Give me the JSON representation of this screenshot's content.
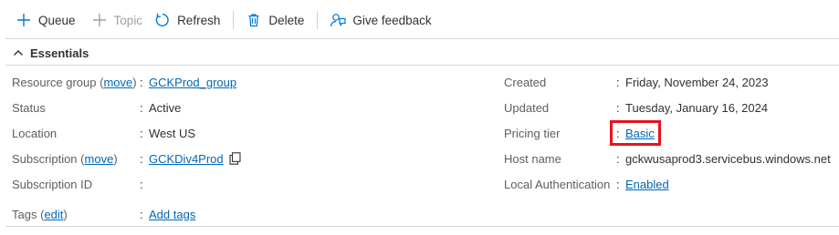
{
  "toolbar": {
    "queue_label": "Queue",
    "topic_label": "Topic",
    "refresh_label": "Refresh",
    "delete_label": "Delete",
    "feedback_label": "Give feedback"
  },
  "essentials": {
    "title": "Essentials"
  },
  "left": {
    "resource_group": {
      "label": "Resource group",
      "paren_open": "(",
      "move": "move",
      "paren_close": ")",
      "colon": ":",
      "value": "GCKProd_group"
    },
    "status": {
      "label": "Status",
      "colon": ":",
      "value": "Active"
    },
    "location": {
      "label": "Location",
      "colon": ":",
      "value": "West US"
    },
    "subscription": {
      "label": "Subscription",
      "paren_open": "(",
      "move": "move",
      "paren_close": ")",
      "colon": ":",
      "value": "GCKDiv4Prod"
    },
    "subscription_id": {
      "label": "Subscription ID",
      "colon": ":",
      "value": ""
    },
    "tags": {
      "label": "Tags",
      "paren_open": "(",
      "edit": "edit",
      "paren_close": ")",
      "colon": ":",
      "value": "Add tags"
    }
  },
  "right": {
    "created": {
      "label": "Created",
      "colon": ":",
      "value": "Friday, November 24, 2023"
    },
    "updated": {
      "label": "Updated",
      "colon": ":",
      "value": "Tuesday, January 16, 2024"
    },
    "pricing_tier": {
      "label": "Pricing tier",
      "colon": ":",
      "value": "Basic"
    },
    "host_name": {
      "label": "Host name",
      "colon": ":",
      "value": "gckwusaprod3.servicebus.windows.net"
    },
    "local_auth": {
      "label": "Local Authentication",
      "colon": ":",
      "value": "Enabled"
    }
  },
  "colors": {
    "link": "#0067b8",
    "highlight": "#e8121e",
    "accent_icon": "#0078d4"
  },
  "icons": {
    "queue": "plus-icon",
    "topic": "plus-icon",
    "refresh": "refresh-icon",
    "delete": "trash-icon",
    "feedback": "feedback-icon",
    "essentials": "chevron-up-icon",
    "copy": "copy-icon"
  }
}
